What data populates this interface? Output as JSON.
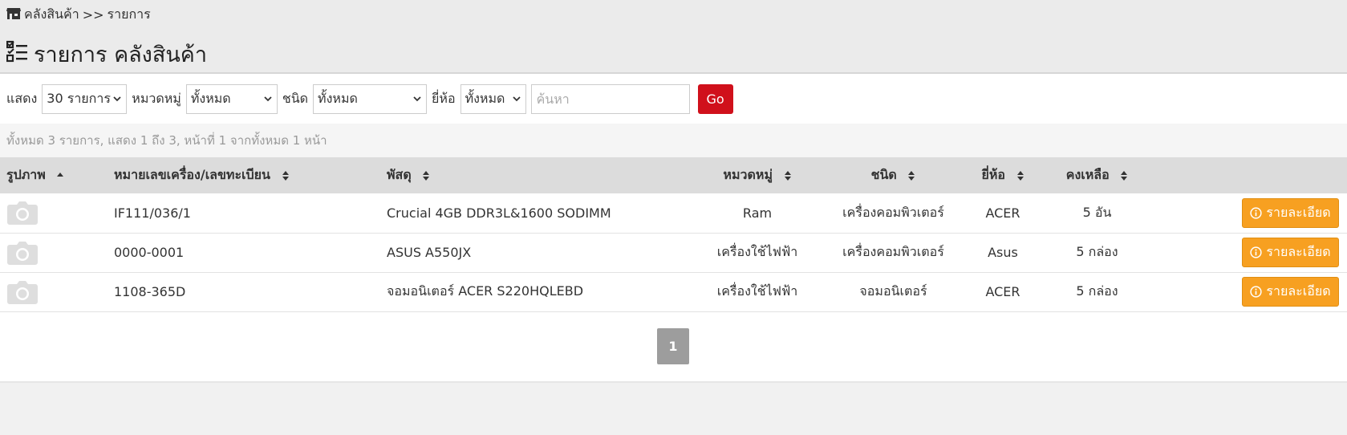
{
  "breadcrumb": {
    "store": "คลังสินค้า",
    "separator": ">>",
    "current": "รายการ"
  },
  "title": "รายการ คลังสินค้า",
  "filters": {
    "show_label": "แสดง",
    "show_value": "30 รายการ",
    "category_label": "หมวดหมู่",
    "category_value": "ทั้งหมด",
    "type_label": "ชนิด",
    "type_value": "ทั้งหมด",
    "brand_label": "ยี่ห้อ",
    "brand_value": "ทั้งหมด",
    "search_placeholder": "ค้นหา",
    "go_label": "Go"
  },
  "summary": "ทั้งหมด 3 รายการ, แสดง 1 ถึง 3, หน้าที่ 1 จากทั้งหมด 1 หน้า",
  "table": {
    "headers": [
      "รูปภาพ",
      "หมายเลขเครื่อง/เลขทะเบียน",
      "พัสดุ",
      "หมวดหมู่",
      "ชนิด",
      "ยี่ห้อ",
      "คงเหลือ"
    ],
    "rows": [
      {
        "code": "IF111/036/1",
        "item": "Crucial 4GB DDR3L&1600 SODIMM",
        "category": "Ram",
        "type": "เครื่องคอมพิวเตอร์",
        "brand": "ACER",
        "stock": "5 อัน",
        "action": "รายละเอียด"
      },
      {
        "code": "0000-0001",
        "item": "ASUS A550JX",
        "category": "เครื่องใช้ไฟฟ้า",
        "type": "เครื่องคอมพิวเตอร์",
        "brand": "Asus",
        "stock": "5 กล่อง",
        "action": "รายละเอียด"
      },
      {
        "code": "1108-365D",
        "item": "จอมอนิเตอร์ ACER S220HQLEBD",
        "category": "เครื่องใช้ไฟฟ้า",
        "type": "จอมอนิเตอร์",
        "brand": "ACER",
        "stock": "5 กล่อง",
        "action": "รายละเอียด"
      }
    ]
  },
  "pagination": {
    "current": "1"
  },
  "colors": {
    "go": "#d0101b",
    "detail": "#f7a021",
    "header_bg": "#dcdcdc",
    "page_active": "#9d9d9d"
  },
  "icons": {
    "breadcrumb": "store-icon",
    "title": "checklist-icon",
    "row_image": "camera-icon",
    "detail": "info-circle-icon"
  }
}
